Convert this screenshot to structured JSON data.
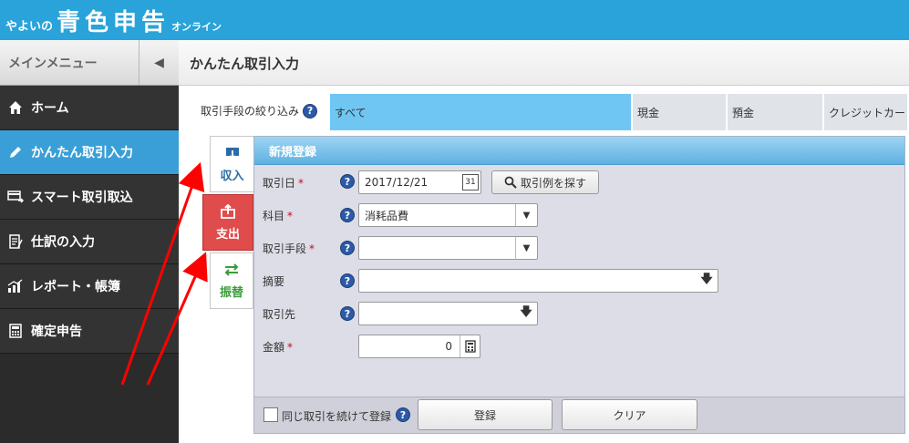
{
  "header": {
    "brand_small": "やよいの",
    "brand_big": "青色申告",
    "brand_suffix": "オンライン"
  },
  "sidebar": {
    "heading": "メインメニュー",
    "items": [
      {
        "label": "ホーム",
        "icon": "home-icon"
      },
      {
        "label": "かんたん取引入力",
        "icon": "pencil-icon",
        "active": true
      },
      {
        "label": "スマート取引取込",
        "icon": "card-import-icon"
      },
      {
        "label": "仕訳の入力",
        "icon": "journal-icon"
      },
      {
        "label": "レポート・帳簿",
        "icon": "chart-report-icon"
      },
      {
        "label": "確定申告",
        "icon": "calculator-icon"
      }
    ]
  },
  "main": {
    "title": "かんたん取引入力",
    "filter": {
      "label": "取引手段の絞り込み",
      "tabs": [
        {
          "label": "すべて",
          "active": true
        },
        {
          "label": "現金"
        },
        {
          "label": "預金"
        },
        {
          "label": "クレジットカード"
        }
      ]
    },
    "type_tabs": [
      {
        "label": "収入",
        "icon": "income-icon"
      },
      {
        "label": "支出",
        "icon": "expense-icon"
      },
      {
        "label": "振替",
        "icon": "transfer-icon"
      }
    ],
    "form": {
      "heading": "新規登録",
      "required_mark": "*",
      "date_label": "取引日",
      "date_value": "2017/12/21",
      "calendar_day": "31",
      "find_example_button": "取引例を探す",
      "account_label": "科目",
      "account_value": "消耗品費",
      "method_label": "取引手段",
      "method_value": "",
      "memo_label": "摘要",
      "memo_value": "",
      "partner_label": "取引先",
      "partner_value": "",
      "amount_label": "金額",
      "amount_value": "0",
      "repeat_checkbox_label": "同じ取引を続けて登録",
      "register_button": "登録",
      "clear_button": "クリア"
    }
  },
  "colors": {
    "header": "#29a3d9",
    "sidebar_active": "#3a9fd6",
    "expense_tab": "#e04b4b",
    "annotation_arrow": "#ff0000"
  }
}
